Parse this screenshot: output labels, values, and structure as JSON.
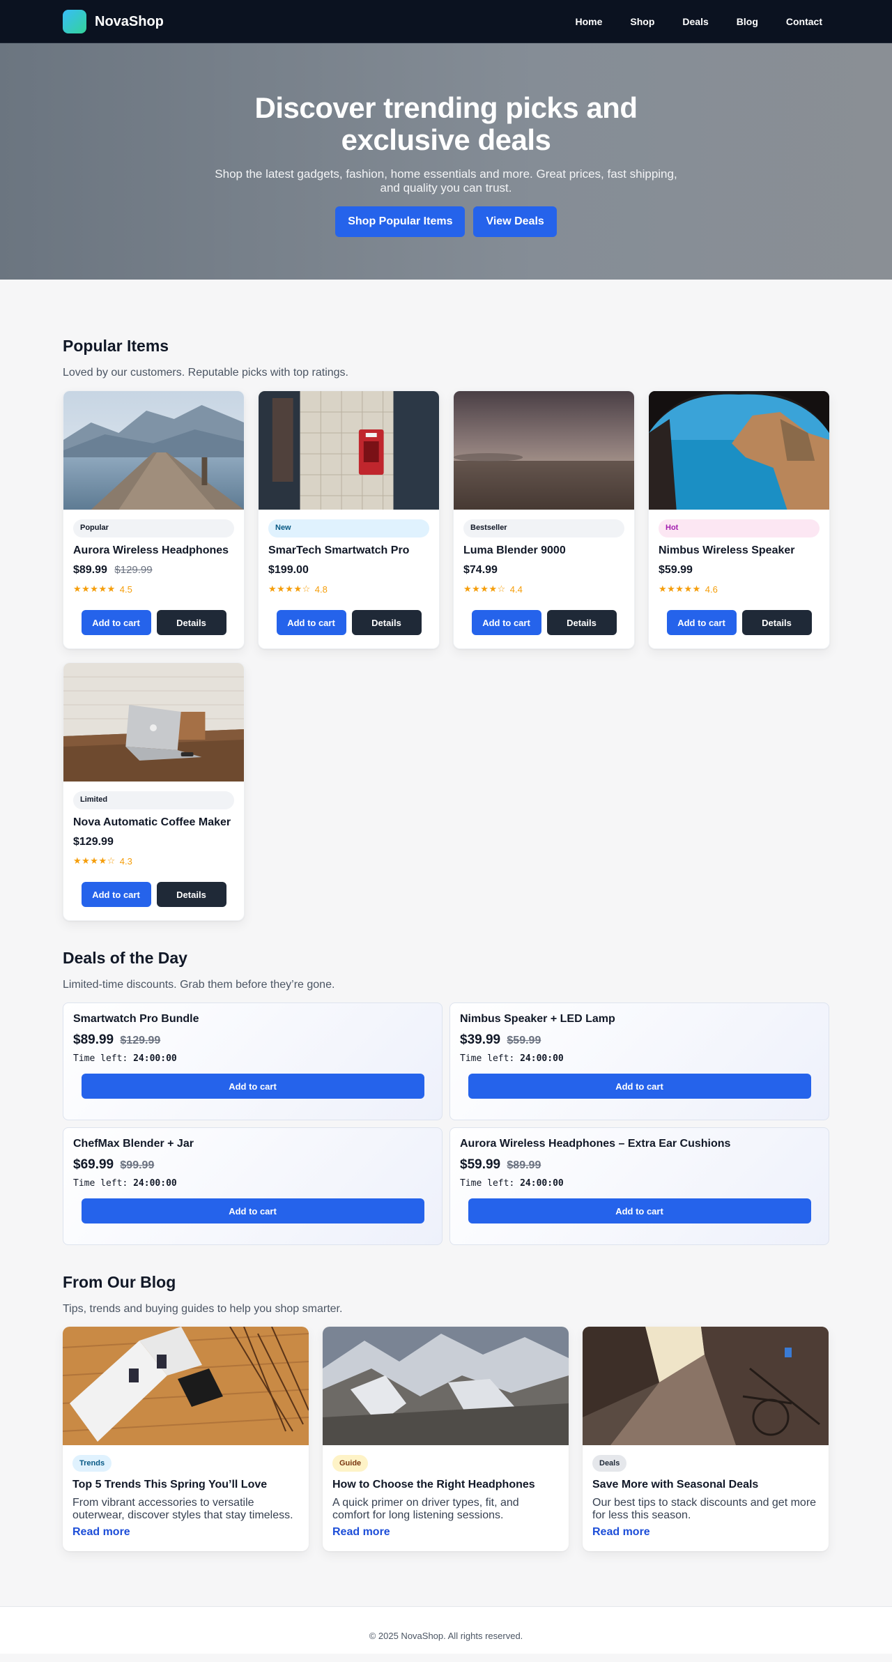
{
  "brand": {
    "name": "NovaShop"
  },
  "nav": [
    "Home",
    "Shop",
    "Deals",
    "Blog",
    "Contact"
  ],
  "hero": {
    "title": "Discover trending picks and exclusive deals",
    "subtitle": "Shop the latest gadgets, fashion, home essentials and more. Great prices, fast shipping, and quality you can trust.",
    "btn_primary": "Shop Popular Items",
    "btn_secondary": "View Deals"
  },
  "popular": {
    "title": "Popular Items",
    "subtitle": "Loved by our customers. Reputable picks with top ratings.",
    "add_label": "Add to cart",
    "details_label": "Details",
    "items": [
      {
        "badge": "Popular",
        "name": "Aurora Wireless Headphones",
        "price": "$89.99",
        "old_price": "$129.99",
        "stars": "★★★★★",
        "rating": "4.5"
      },
      {
        "badge": "New",
        "name": "SmarTech Smartwatch Pro",
        "price": "$199.00",
        "old_price": "",
        "stars": "★★★★☆",
        "rating": "4.8"
      },
      {
        "badge": "Bestseller",
        "name": "Luma Blender 9000",
        "price": "$74.99",
        "old_price": "",
        "stars": "★★★★☆",
        "rating": "4.4"
      },
      {
        "badge": "Hot",
        "name": "Nimbus Wireless Speaker",
        "price": "$59.99",
        "old_price": "",
        "stars": "★★★★★",
        "rating": "4.6"
      },
      {
        "badge": "Limited",
        "name": "Nova Automatic Coffee Maker",
        "price": "$129.99",
        "old_price": "",
        "stars": "★★★★☆",
        "rating": "4.3"
      }
    ]
  },
  "deals": {
    "title": "Deals of the Day",
    "subtitle": "Limited-time discounts. Grab them before they’re gone.",
    "timer_label": "Time left:",
    "add_label": "Add to cart",
    "items": [
      {
        "name": "Smartwatch Pro Bundle",
        "price": "$89.99",
        "old_price": "$129.99",
        "time": "24:00:00"
      },
      {
        "name": "Nimbus Speaker + LED Lamp",
        "price": "$39.99",
        "old_price": "$59.99",
        "time": "24:00:00"
      },
      {
        "name": "ChefMax Blender + Jar",
        "price": "$69.99",
        "old_price": "$99.99",
        "time": "24:00:00"
      },
      {
        "name": "Aurora Wireless Headphones – Extra Ear Cushions",
        "price": "$59.99",
        "old_price": "$89.99",
        "time": "24:00:00"
      }
    ]
  },
  "blog": {
    "title": "From Our Blog",
    "subtitle": "Tips, trends and buying guides to help you shop smarter.",
    "read_more": "Read more",
    "posts": [
      {
        "tag": "Trends",
        "title": "Top 5 Trends This Spring You’ll Love",
        "text": "From vibrant accessories to versatile outerwear, discover styles that stay timeless."
      },
      {
        "tag": "Guide",
        "title": "How to Choose the Right Headphones",
        "text": "A quick primer on driver types, fit, and comfort for long listening sessions."
      },
      {
        "tag": "Deals",
        "title": "Save More with Seasonal Deals",
        "text": "Our best tips to stack discounts and get more for less this season."
      }
    ]
  },
  "footer": {
    "text": "© 2025 NovaShop. All rights reserved."
  },
  "colors": {
    "accent": "#2563eb",
    "dark": "#1f2937",
    "nav_bg": "#0b1220",
    "star": "#f59e0b"
  }
}
